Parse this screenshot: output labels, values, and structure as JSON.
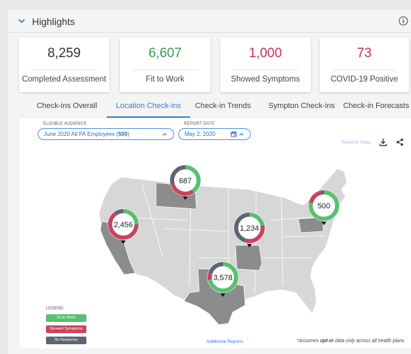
{
  "header": {
    "title": "Highlights"
  },
  "kpis": [
    {
      "value": "8,259",
      "label": "Completed Assessment",
      "color": "#333333"
    },
    {
      "value": "6,607",
      "label": "Fit to Work",
      "color": "#3a9a4f"
    },
    {
      "value": "1,000",
      "label": "Showed Symptoms",
      "color": "#c23358"
    },
    {
      "value": "73",
      "label": "COVID-19 Positive",
      "color": "#c23358"
    }
  ],
  "tabs": [
    {
      "label": "Check-ins Overall",
      "active": false
    },
    {
      "label": "Location Check-ins",
      "active": true
    },
    {
      "label": "Check-in Trends",
      "active": false
    },
    {
      "label": "Sympton Check-ins",
      "active": false
    },
    {
      "label": "Check-in Forecasts",
      "active": false
    }
  ],
  "filters": {
    "audience_label": "ELIGIBLE AUDIENCE",
    "audience_prefix": "June 2020 All PA Employees (",
    "audience_count": "500",
    "audience_suffix": ")",
    "date_label": "REPORT DATE",
    "date_value": "May 2, 2020",
    "return_to_today": "Return to Today"
  },
  "colors": {
    "fit": "#58c06f",
    "symptoms": "#c9445f",
    "no_response": "#5d6474",
    "accent": "#2f7fd8"
  },
  "markers": [
    {
      "state": "Montana",
      "value": "687",
      "fit": 0.4,
      "symptoms": 0.3,
      "no_response": 0.3
    },
    {
      "state": "California",
      "value": "2,456",
      "fit": 0.25,
      "symptoms": 0.65,
      "no_response": 0.1
    },
    {
      "state": "Missouri",
      "value": "1,234",
      "fit": 0.22,
      "symptoms": 0.33,
      "no_response": 0.45
    },
    {
      "state": "Pennsylvania",
      "value": "500",
      "fit": 0.78,
      "symptoms": 0.18,
      "no_response": 0.04
    },
    {
      "state": "Texas",
      "value": "3,578",
      "fit": 0.72,
      "symptoms": 0.08,
      "no_response": 0.2
    }
  ],
  "legend": {
    "title": "LEGEND",
    "items": [
      {
        "label": "Fit to Work",
        "color": "#58c06f"
      },
      {
        "label": "Showed Symptoms",
        "color": "#c9445f"
      },
      {
        "label": "No Response",
        "color": "#5d6474"
      }
    ]
  },
  "footer": {
    "additional_reports": "Additional Reports",
    "note_prefix": "*Assumes ",
    "note_bold": "opt-in",
    "note_suffix": " data only across all health plans"
  }
}
